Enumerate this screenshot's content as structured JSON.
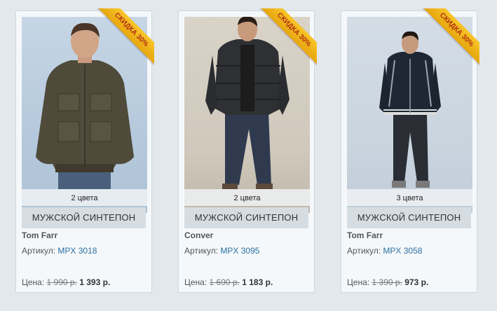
{
  "products": [
    {
      "badge": "СКИДКА 30%",
      "colors": "2 цвета",
      "category": "МУЖСКОЙ СИНТЕПОН",
      "brand": "Tom Farr",
      "article_label": "Артикул:",
      "article_value": "MPX 3018",
      "price_label": "Цена:",
      "old_price": "1 990 р.",
      "new_price": "1 393 р."
    },
    {
      "badge": "СКИДКА 30%",
      "colors": "2 цвета",
      "category": "МУЖСКОЙ СИНТЕПОН",
      "brand": "Conver",
      "article_label": "Артикул:",
      "article_value": "MPX 3095",
      "price_label": "Цена:",
      "old_price": "1 690 р.",
      "new_price": "1 183 р."
    },
    {
      "badge": "СКИДКА 30%",
      "colors": "3 цвета",
      "category": "МУЖСКОЙ СИНТЕПОН",
      "brand": "Tom Farr",
      "article_label": "Артикул:",
      "article_value": "MPX 3058",
      "price_label": "Цена:",
      "old_price": "1 390 р.",
      "new_price": "973 р."
    }
  ],
  "colors": {
    "page_bg": "#e3e8ec",
    "card_bg": "#f5f8fa",
    "ribbon": "#f0b51c",
    "ribbon_text": "#b03010",
    "link": "#2a6fa3"
  }
}
